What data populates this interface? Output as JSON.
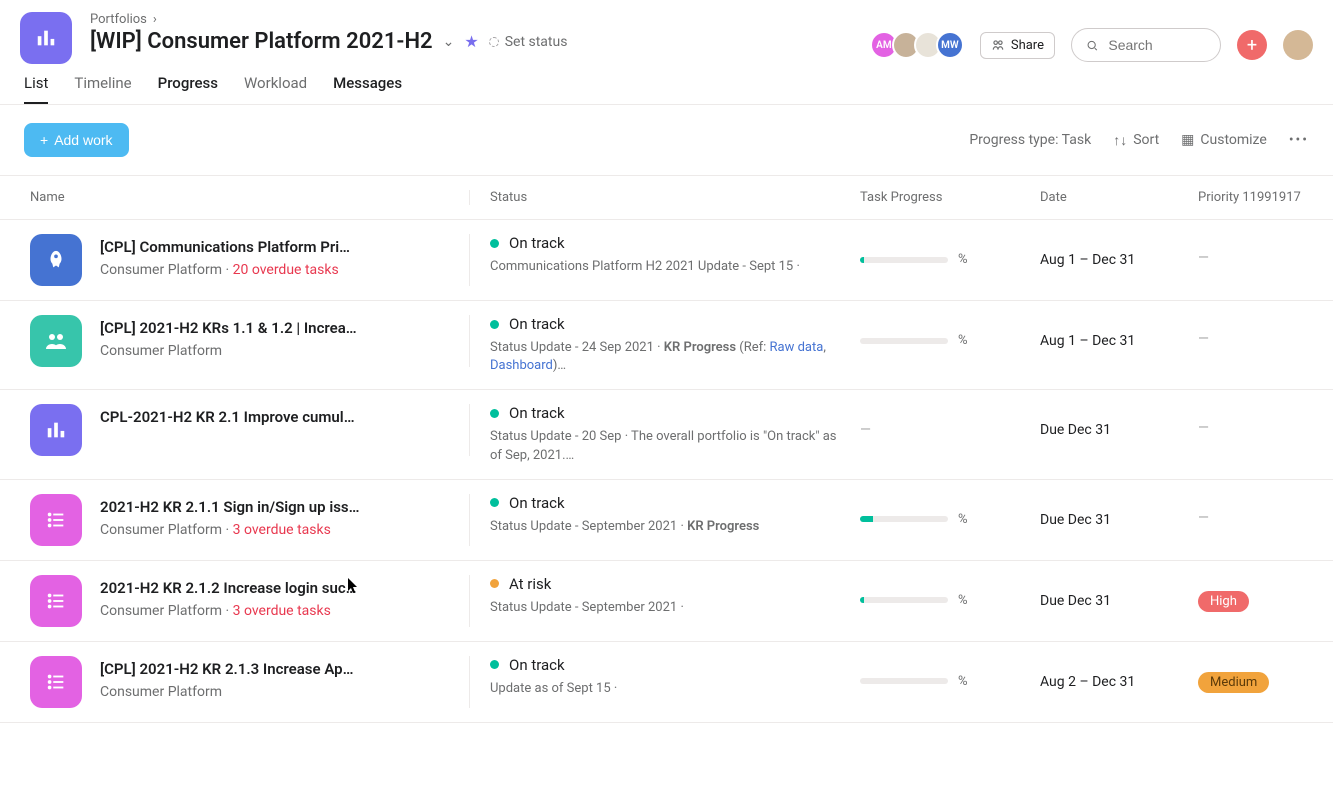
{
  "breadcrumb": {
    "parent": "Portfolios"
  },
  "title": "[WIP] Consumer Platform 2021-H2",
  "set_status": "Set status",
  "share_label": "Share",
  "search": {
    "placeholder": "Search"
  },
  "avatars": [
    {
      "initials": "AM",
      "color": "#e362e3"
    },
    {
      "initials": "",
      "color": "#c7b299"
    },
    {
      "initials": "",
      "color": "#e8e3d9"
    },
    {
      "initials": "MW",
      "color": "#4573d2"
    }
  ],
  "tabs": {
    "list": "List",
    "timeline": "Timeline",
    "progress": "Progress",
    "workload": "Workload",
    "messages": "Messages"
  },
  "toolbar": {
    "add_work": "Add work",
    "progress_type": "Progress type: Task",
    "sort": "Sort",
    "customize": "Customize"
  },
  "columns": {
    "name": "Name",
    "status": "Status",
    "progress": "Task Progress",
    "date": "Date",
    "priority": "Priority 11991917"
  },
  "rows": [
    {
      "icon_type": "rocket",
      "icon_bg": "#4573d2",
      "name": "[CPL] Communications Platform Pri…",
      "subtitle": "Consumer Platform",
      "overdue": "20 overdue tasks",
      "status": "On track",
      "status_color": "green",
      "status_desc": "Communications Platform H2 2021 Update - Sept 15 ·",
      "progress_pct": 5,
      "progress_text": "%",
      "date": "Aug 1 – Dec 31",
      "priority": "—"
    },
    {
      "icon_type": "users",
      "icon_bg": "#37c5ab",
      "name": "[CPL] 2021-H2 KRs 1.1 & 1.2 | Increa…",
      "subtitle": "Consumer Platform",
      "overdue": "",
      "status": "On track",
      "status_color": "green",
      "status_desc_html": "Status Update - 24 Sep 2021 · <span class=\"bold\">KR Progress</span> (Ref: <a>Raw data</a>, <a>Dashboard</a>)…",
      "progress_pct": 0,
      "progress_text": "%",
      "date": "Aug 1 – Dec 31",
      "priority": "—"
    },
    {
      "icon_type": "bars",
      "icon_bg": "#7a6ff0",
      "name": "CPL-2021-H2 KR 2.1 Improve cumul…",
      "subtitle": "",
      "overdue": "",
      "status": "On track",
      "status_color": "green",
      "status_desc": "Status Update - 20 Sep · The overall portfolio is \"On track\" as of Sep, 2021.…",
      "progress_empty": "—",
      "date": "Due Dec 31",
      "priority": "—"
    },
    {
      "icon_type": "list",
      "icon_bg": "#e362e3",
      "name": "2021-H2 KR 2.1.1 Sign in/Sign up iss…",
      "subtitle": "Consumer Platform",
      "overdue": "3 overdue tasks",
      "status": "On track",
      "status_color": "green",
      "status_desc_html": "Status Update - September 2021 · <span class=\"bold\">KR Progress</span>",
      "progress_pct": 15,
      "progress_text": "%",
      "date": "Due Dec 31",
      "priority": "—"
    },
    {
      "icon_type": "list",
      "icon_bg": "#e362e3",
      "name": "2021-H2 KR 2.1.2 Increase login suc…",
      "subtitle": "Consumer Platform",
      "overdue": "3 overdue tasks",
      "status": "At risk",
      "status_color": "orange",
      "status_desc": "Status Update - September 2021 ·",
      "progress_pct": 4,
      "progress_text": "%",
      "date": "Due Dec 31",
      "priority_badge": "High",
      "priority_badge_class": "badge-high"
    },
    {
      "icon_type": "list",
      "icon_bg": "#e362e3",
      "name": "[CPL] 2021-H2 KR 2.1.3 Increase Ap…",
      "subtitle": "Consumer Platform",
      "overdue": "",
      "status": "On track",
      "status_color": "green",
      "status_desc": "Update as of Sept 15 ·",
      "progress_pct": 0,
      "progress_text": "%",
      "date": "Aug 2 – Dec 31",
      "priority_badge": "Medium",
      "priority_badge_class": "badge-medium"
    }
  ]
}
